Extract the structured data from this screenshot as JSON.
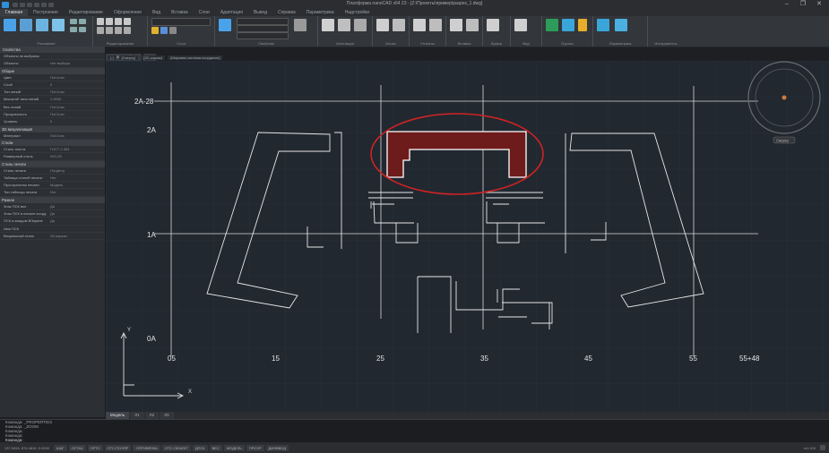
{
  "window": {
    "title": "Платформа nanoCAD x64 23 - [Z:\\Проекты\\пример\\разрез_1.dwg]",
    "controls": [
      "–",
      "❐",
      "✕"
    ]
  },
  "ribbon_tabs": [
    "Главная",
    "Построение",
    "Редактирование",
    "Оформление",
    "Вид",
    "Вставка",
    "Слои",
    "Адаптация",
    "Вывод",
    "Справка",
    "Параметрика",
    "Надстройки"
  ],
  "ribbon_groups": [
    "Рисование",
    "Редактирование",
    "Слои",
    "Свойства",
    "Аннотации",
    "Блоки",
    "Утилиты",
    "Вставка",
    "Буфер",
    "Вид",
    "Группы",
    "Параметрика",
    "Инструменты"
  ],
  "doc_tabs": [
    "Чертёж1.dwg",
    "+"
  ],
  "view_controls": [
    "[-]",
    "[Сверху]",
    "[2D-каркас]",
    "[Мировая система координат]"
  ],
  "properties": {
    "header": "Свойства",
    "filter": "Объекты не выбраны",
    "rows": [
      {
        "k": "Объекты",
        "v": "Нет выбора"
      },
      {
        "section": "Общие"
      },
      {
        "k": "Цвет",
        "v": "ПоСлою"
      },
      {
        "k": "Слой",
        "v": "0"
      },
      {
        "k": "Тип линий",
        "v": "ПоСлою"
      },
      {
        "k": "Масштаб типа линий",
        "v": "1.0000"
      },
      {
        "k": "Вес линий",
        "v": "ПоСлою"
      },
      {
        "k": "Прозрачность",
        "v": "ПоСлою"
      },
      {
        "k": "Уровень",
        "v": "0"
      },
      {
        "section": "3D визуализация"
      },
      {
        "k": "Материал",
        "v": "ПоСлою"
      },
      {
        "section": "Стили"
      },
      {
        "k": "Стиль текста",
        "v": "ГОСТ 2.304"
      },
      {
        "k": "Размерный стиль",
        "v": "ISO-25"
      },
      {
        "section": "Стиль печати"
      },
      {
        "k": "Стиль печати",
        "v": "ПоЦвету"
      },
      {
        "k": "Таблица стилей печати",
        "v": "Нет"
      },
      {
        "k": "Пространство печати",
        "v": "Модель"
      },
      {
        "k": "Тип таблицы печати",
        "v": "Нет"
      },
      {
        "section": "Разное"
      },
      {
        "k": "Знак ПСК вкл",
        "v": "Да"
      },
      {
        "k": "Знак ПСК в начале коорд.",
        "v": "Да"
      },
      {
        "k": "ПСК в каждом ВЭкране",
        "v": "Да"
      },
      {
        "k": "Имя ПСК",
        "v": ""
      },
      {
        "k": "Визуальный стиль",
        "v": "2D-каркас"
      }
    ]
  },
  "drawing": {
    "axis_labels_y": [
      "2А-28",
      "2А",
      "1А",
      "0А"
    ],
    "axis_labels_x": [
      "05",
      "15",
      "25",
      "35",
      "45",
      "55",
      "55+48"
    ],
    "ucs": {
      "x": "X",
      "y": "Y"
    },
    "compass": "Сверху"
  },
  "layout_tabs": [
    "Модель",
    "Л1",
    "Л2",
    "Л3"
  ],
  "command_history": [
    "Команда: _PROPERTIES",
    "Команда: _ZOOM",
    "Команда:",
    "Команда:"
  ],
  "command_prompt": "Команда:",
  "status_bar": {
    "coords": "137.5264, 874.4816, 0.0000",
    "toggles": [
      "ШАГ",
      "СЕТКА",
      "ОРТО",
      "ОТС-ПОЛЯР",
      "ОПРИВЯЗКА",
      "ОТС-ОБЪЕКТ",
      "ДПСК",
      "ВЕС",
      "МОДЕЛЬ",
      "ПРОЗР",
      "ДИНВВОД"
    ],
    "scale": "m1:100"
  },
  "colors": {
    "highlight": "#d02323",
    "fill": "#6e1b1b",
    "canvas": "#212830"
  }
}
